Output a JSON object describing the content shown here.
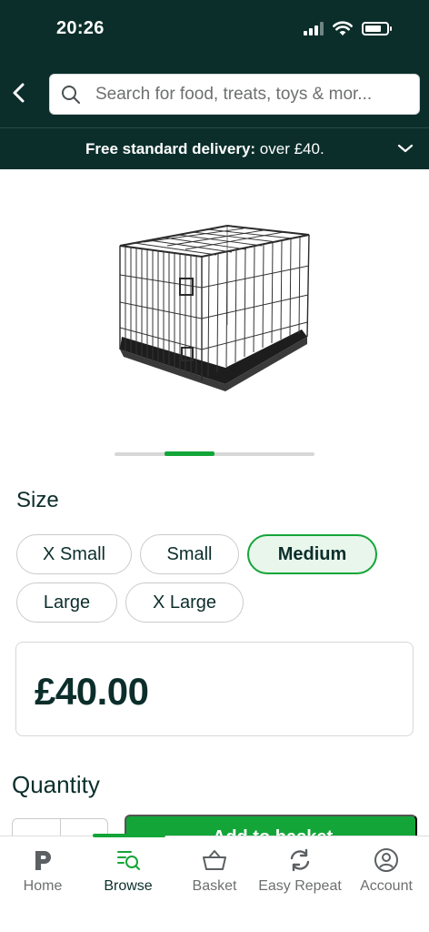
{
  "status_bar": {
    "time": "20:26"
  },
  "search": {
    "placeholder": "Search for food, treats, toys & mor..."
  },
  "delivery": {
    "bold": "Free standard delivery:",
    "rest": " over £40."
  },
  "product": {
    "image": "dog-crate-image",
    "carousel": {
      "active_index": 1,
      "count": 4
    }
  },
  "size": {
    "heading": "Size",
    "options": [
      "X Small",
      "Small",
      "Medium",
      "Large",
      "X Large"
    ],
    "selected": "Medium"
  },
  "price": "£40.00",
  "quantity": {
    "heading": "Quantity"
  },
  "add_to_basket": {
    "label": "Add to basket"
  },
  "tabs": [
    {
      "label": "Home",
      "icon": "home-p-logo-icon"
    },
    {
      "label": "Browse",
      "icon": "browse-icon",
      "active": true
    },
    {
      "label": "Basket",
      "icon": "basket-icon"
    },
    {
      "label": "Easy Repeat",
      "icon": "easy-repeat-icon"
    },
    {
      "label": "Account",
      "icon": "account-icon"
    }
  ],
  "colors": {
    "header": "#0b2e2b",
    "accent": "#13a538",
    "selected_bg": "#e9f6ec"
  }
}
